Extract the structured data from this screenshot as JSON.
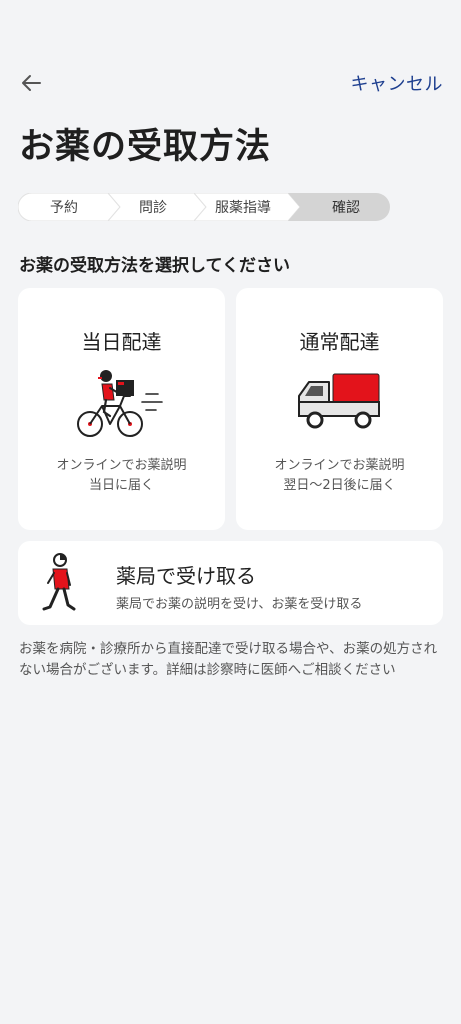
{
  "header": {
    "back_icon": "arrow-left-icon",
    "cancel_label": "キャンセル"
  },
  "page_title": "お薬の受取方法",
  "stepper": {
    "steps": [
      "予約",
      "問診",
      "服薬指導",
      "確認"
    ],
    "current_index": 3
  },
  "subtitle": "お薬の受取方法を選択してください",
  "options": {
    "same_day": {
      "title": "当日配達",
      "icon": "delivery-bicycle-icon",
      "desc_line1": "オンラインでお薬説明",
      "desc_line2": "当日に届く"
    },
    "normal": {
      "title": "通常配達",
      "icon": "delivery-truck-icon",
      "desc_line1": "オンラインでお薬説明",
      "desc_line2": "翌日〜2日後に届く"
    },
    "pharmacy": {
      "title": "薬局で受け取る",
      "icon": "walking-person-icon",
      "desc": "薬局でお薬の説明を受け、お薬を受け取る"
    }
  },
  "note": "お薬を病院・診療所から直接配達で受け取る場合や、お薬の処方されない場合がございます。詳細は診察時に医師へご相談ください",
  "colors": {
    "accent": "#1e3f8f",
    "brand_red": "#e3131b",
    "background": "#f3f4f6",
    "step_current_bg": "#d4d4d4"
  }
}
